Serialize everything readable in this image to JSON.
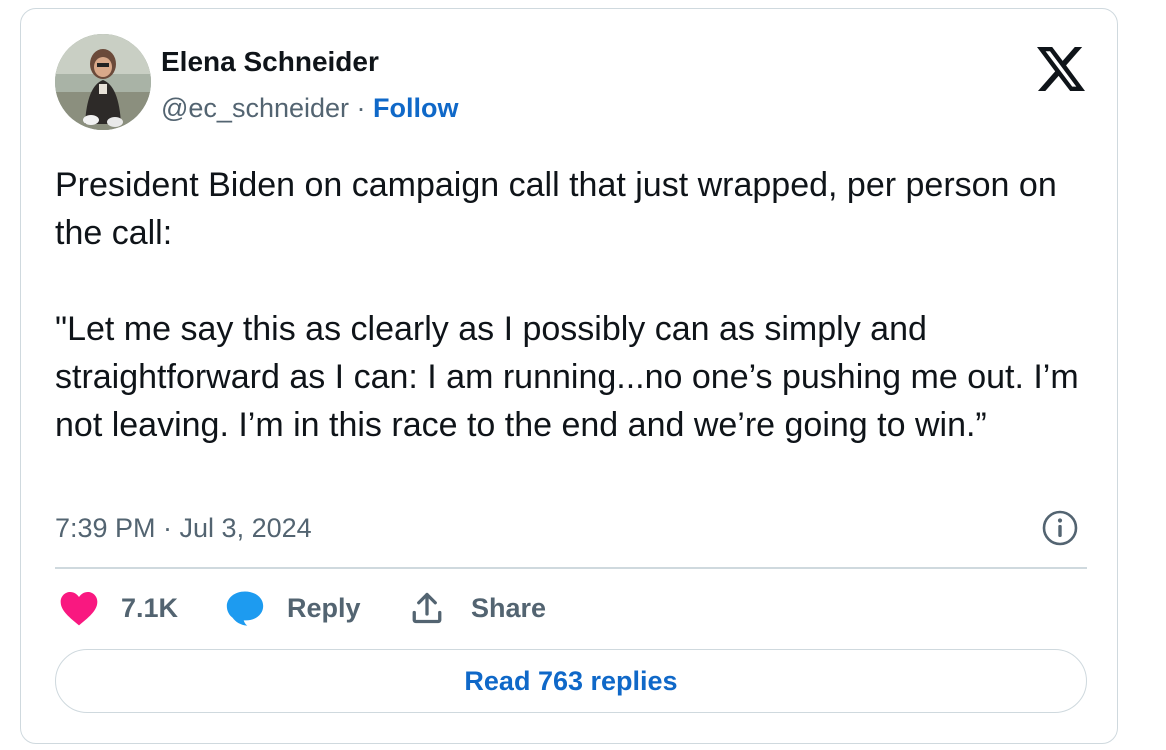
{
  "author": {
    "name": "Elena Schneider",
    "handle": "@ec_schneider",
    "separator": " · ",
    "follow_label": "Follow",
    "avatar_icon": "profile-photo"
  },
  "tweet": {
    "paragraphs": [
      "President Biden on campaign call that just wrapped, per person on the call:",
      "\"Let me say this as clearly as I possibly can as simply and straightforward as I can: I am running...no one’s pushing me out. I’m not leaving. I’m in this race to the end and we’re going to win.”"
    ],
    "timestamp": "7:39 PM · Jul 3, 2024"
  },
  "actions": {
    "like_count": "7.1K",
    "reply_label": "Reply",
    "share_label": "Share"
  },
  "footer": {
    "read_replies_label": "Read 763 replies"
  },
  "icons": {
    "brand": "x-logo-icon",
    "info": "info-icon",
    "like": "heart-icon",
    "reply": "speech-bubble-icon",
    "share": "share-upload-icon"
  },
  "colors": {
    "like": "#f91880",
    "reply": "#1d9bf0",
    "link": "#0f68c8",
    "secondary_text": "#536471",
    "border": "#cfd9de"
  }
}
